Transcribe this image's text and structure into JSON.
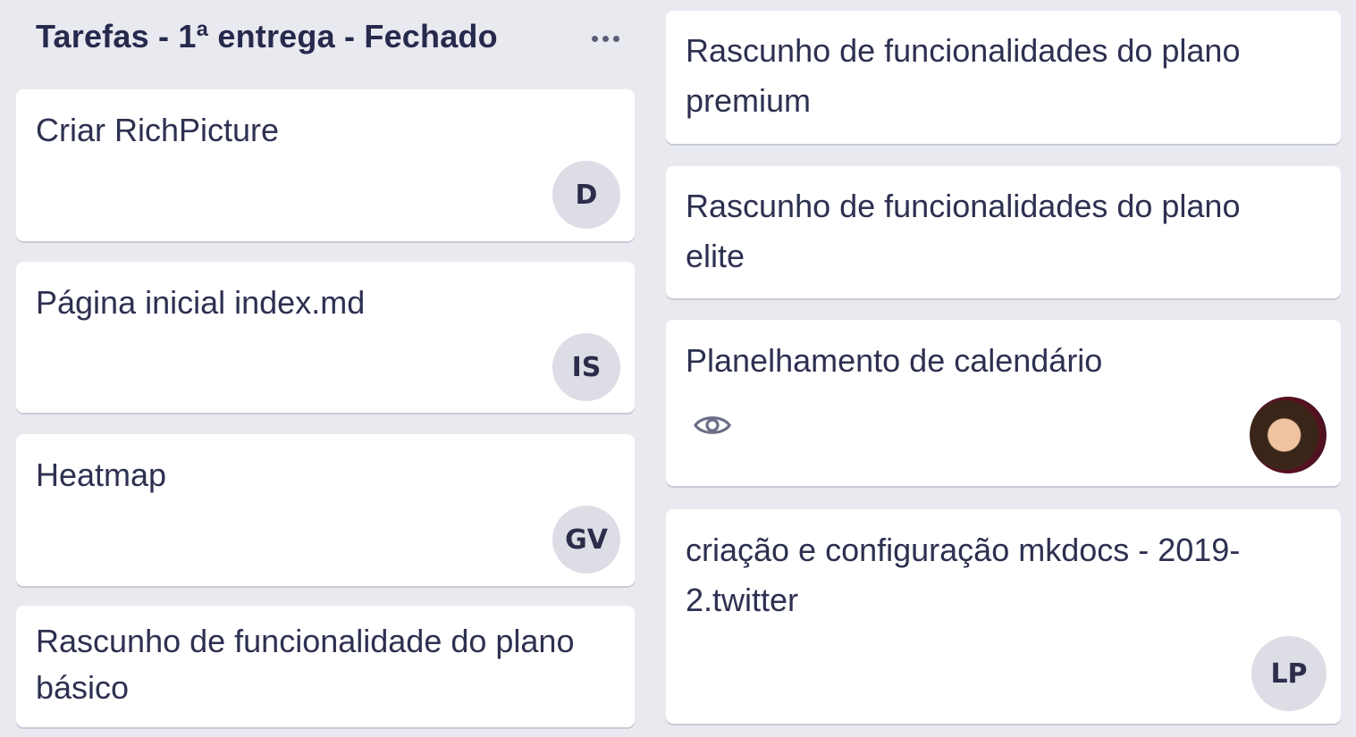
{
  "column": {
    "title": "Tarefas - 1ª entrega - Fechado",
    "menu_icon": "ellipsis-icon"
  },
  "left_cards": [
    {
      "title": "Criar RichPicture",
      "member": "D"
    },
    {
      "title": "Página inicial index.md",
      "member": "IS"
    },
    {
      "title": "Heatmap",
      "member": "GV"
    },
    {
      "title": "Rascunho de funcionalidade do plano básico"
    }
  ],
  "right_cards": [
    {
      "title": "Rascunho de funcionalidades do plano premium"
    },
    {
      "title": "Rascunho de funcionalidades do plano elite"
    },
    {
      "title": "Planelhamento de calendário",
      "badge_icon": "eye-icon",
      "member_icon": "photo-avatar"
    },
    {
      "title": "criação e configuração mkdocs - 2019-2.twitter",
      "member": "LP"
    }
  ]
}
